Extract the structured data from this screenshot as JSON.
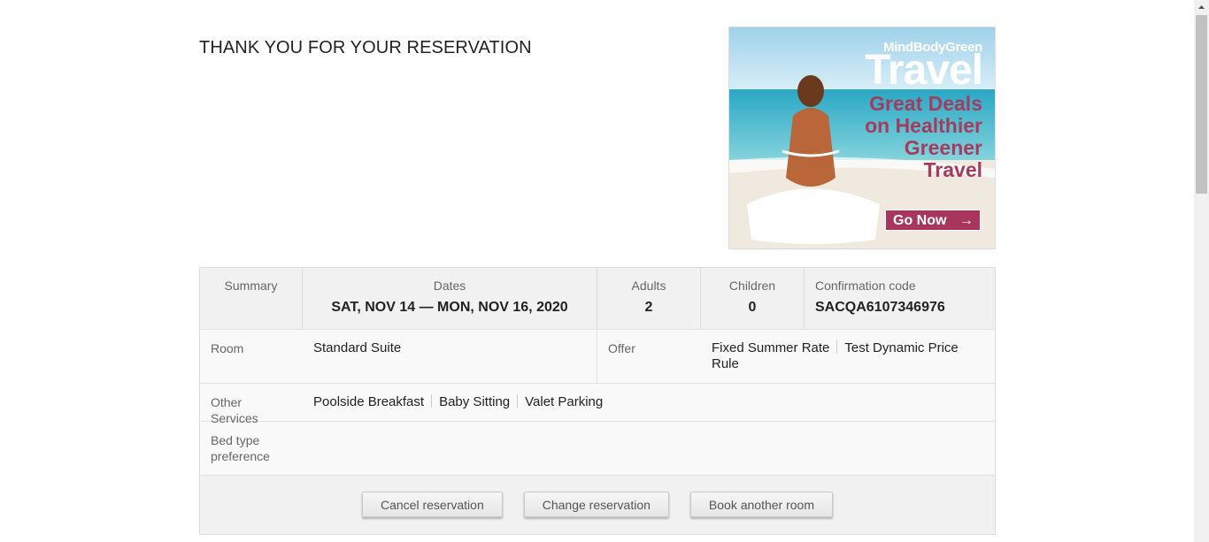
{
  "page": {
    "title": "THANK YOU FOR YOUR RESERVATION"
  },
  "ad": {
    "brand": "MindBodyGreen",
    "headline": "Travel",
    "tagline": "Great Deals on Healthier Greener Travel",
    "cta": "Go Now",
    "cta_icon": "arrow-right-icon"
  },
  "summary": {
    "summary_label": "Summary",
    "dates_label": "Dates",
    "dates_value": "SAT, NOV 14 — MON, NOV 16, 2020",
    "adults_label": "Adults",
    "adults_value": "2",
    "children_label": "Children",
    "children_value": "0",
    "confirmation_label": "Confirmation code",
    "confirmation_value": "SACQA6107346976"
  },
  "details": {
    "room_label": "Room",
    "room_value": "Standard Suite",
    "offer_label": "Offer",
    "offers": [
      "Fixed Summer Rate",
      "Test Dynamic Price Rule"
    ],
    "services_label": "Other Services",
    "services": [
      "Poolside Breakfast",
      "Baby Sitting",
      "Valet Parking"
    ],
    "bed_label": "Bed type preference",
    "bed_value": ""
  },
  "actions": {
    "cancel": "Cancel reservation",
    "change": "Change reservation",
    "book": "Book another room"
  }
}
